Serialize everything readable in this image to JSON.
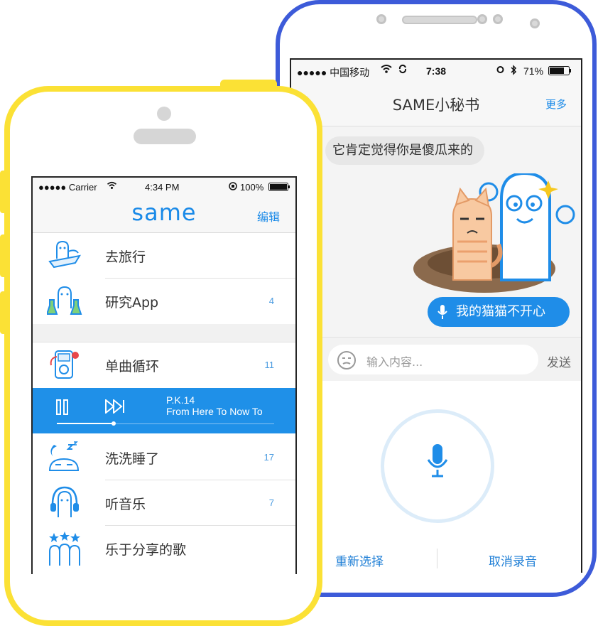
{
  "right_phone": {
    "status": {
      "carrier": "●●●●● 中国移动",
      "time": "7:38",
      "battery": "71%"
    },
    "nav": {
      "title": "SAME小秘书",
      "more_label": "更多"
    },
    "messages": [
      {
        "side": "left",
        "text": "它肯定觉得你是傻瓜来的"
      },
      {
        "side": "right",
        "type": "voice",
        "text": "我的猫猫不开心"
      }
    ],
    "input": {
      "placeholder": "输入内容...",
      "send_label": "发送"
    },
    "record": {
      "reselect_label": "重新选择",
      "cancel_label": "取消录音"
    }
  },
  "left_phone": {
    "status": {
      "carrier": "●●●●● Carrier",
      "time": "4:34 PM",
      "battery": "100%"
    },
    "nav": {
      "logo": "same",
      "edit_label": "编辑"
    },
    "channels": [
      {
        "label": "去旅行",
        "count": "",
        "icon": "travel-ghost-icon"
      },
      {
        "label": "研究App",
        "count": "4",
        "icon": "lab-ghost-icon"
      },
      {
        "label": "单曲循环",
        "count": "11",
        "icon": "music-player-icon"
      },
      {
        "label": "洗洗睡了",
        "count": "17",
        "icon": "sleep-icon"
      },
      {
        "label": "听音乐",
        "count": "7",
        "icon": "headphones-ghost-icon"
      },
      {
        "label": "乐于分享的歌",
        "count": "",
        "icon": "stars-ghosts-icon"
      }
    ],
    "player": {
      "artist": "P.K.14",
      "song": "From Here To Now To",
      "progress": 0.26
    }
  },
  "colors": {
    "accent": "#1f8de8",
    "yellow_frame": "#fbe135",
    "blue_frame": "#3d5bd9"
  }
}
